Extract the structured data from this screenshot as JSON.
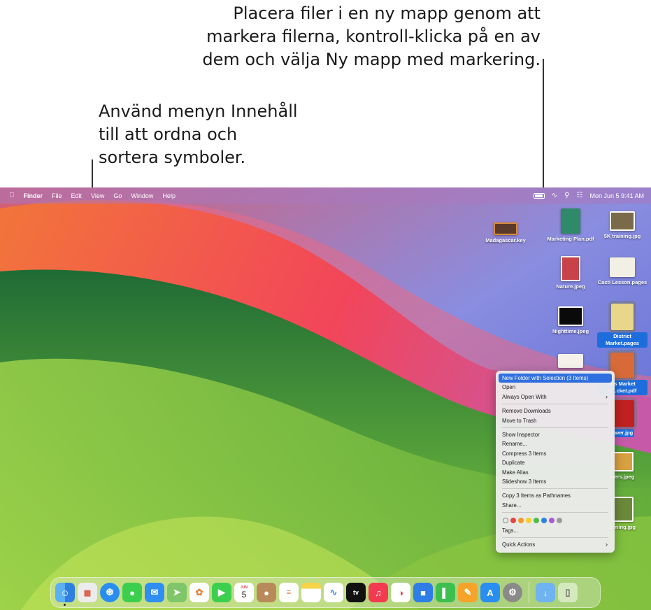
{
  "callouts": {
    "right": [
      "Placera filer i en ny mapp genom att",
      "markera filerna, kontroll-klicka på en av",
      "dem och välja Ny mapp med markering."
    ],
    "left": [
      "Använd menyn Innehåll",
      "till att ordna och",
      "sortera symboler."
    ]
  },
  "menubar": {
    "app": "Finder",
    "items": [
      "File",
      "Edit",
      "View",
      "Go",
      "Window",
      "Help"
    ],
    "clock": "Mon Jun 5  9:41 AM"
  },
  "desktop_icons": [
    {
      "name": "Madagascar.key",
      "selected": false
    },
    {
      "name": "Marketing Plan.pdf",
      "selected": false
    },
    {
      "name": "5K training.jpg",
      "selected": false
    },
    {
      "name": "Nature.jpeg",
      "selected": false
    },
    {
      "name": "Cacti Lesson.pages",
      "selected": false
    },
    {
      "name": "Nighttime.jpeg",
      "selected": false
    },
    {
      "name": "District Market.pages",
      "selected": true
    },
    {
      "name": "ers Market ly...cket.pdf",
      "selected": true
    },
    {
      "name": "ower.jpg",
      "selected": true
    },
    {
      "name": "wers.jpeg",
      "selected": false
    },
    {
      "name": "dening.jpg",
      "selected": false
    }
  ],
  "context_menu": {
    "groups": [
      [
        "New Folder with Selection (3 Items)",
        "Open",
        "Always Open With"
      ],
      [
        "Remove Downloads",
        "Move to Trash"
      ],
      [
        "Show Inspector",
        "Rename...",
        "Compress 3 Items",
        "Duplicate",
        "Make Alias",
        "Slideshow 3 Items"
      ],
      [
        "Copy 3 Items as Pathnames",
        "Share..."
      ]
    ],
    "tag_colors": [
      "#ffffff",
      "#e5473e",
      "#f39b2b",
      "#f7cf2f",
      "#4fbf4a",
      "#2f7ee8",
      "#a85ad6",
      "#9a9a9a"
    ],
    "tags_label": "Tags...",
    "quick_actions": "Quick Actions",
    "highlighted": "New Folder with Selection (3 Items)"
  },
  "dock": {
    "calendar_month": "JUN",
    "calendar_day": "5",
    "apps": [
      "finder-icon",
      "launchpad-icon",
      "safari-icon",
      "messages-icon",
      "mail-icon",
      "maps-icon",
      "photos-icon",
      "facetime-icon",
      "calendar-icon",
      "contacts-icon",
      "reminders-icon",
      "notes-icon",
      "freeform-icon",
      "tv-icon",
      "music-icon",
      "news-icon",
      "keynote-icon",
      "numbers-icon",
      "pages-icon",
      "app-store-icon",
      "settings-icon"
    ],
    "tv_label": "tv"
  }
}
